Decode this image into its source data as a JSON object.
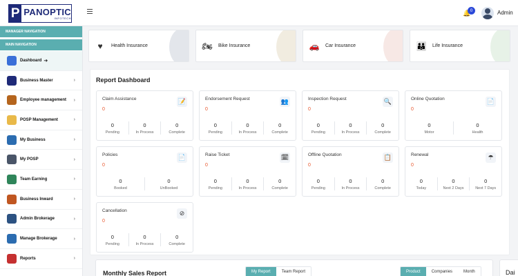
{
  "header": {
    "logo_title": "PANOPTIC",
    "logo_sub": "INFOTECH",
    "notification_count": "0",
    "user_name": "Admin"
  },
  "sidebar": {
    "headings": [
      "MANAGER NAVIGATION",
      "MAIN NAVIGATION"
    ],
    "items": [
      {
        "label": "Dashboard",
        "icon": "dashboard-icon",
        "active": true,
        "arrow": "➔"
      },
      {
        "label": "Business Master",
        "icon": "business-master-icon",
        "arrow": "›"
      },
      {
        "label": "Employee management",
        "icon": "employee-icon",
        "arrow": "›"
      },
      {
        "label": "POSP Management",
        "icon": "posp-icon",
        "arrow": "›"
      },
      {
        "label": "My Business",
        "icon": "my-business-icon",
        "arrow": "›"
      },
      {
        "label": "My POSP",
        "icon": "my-posp-icon",
        "arrow": "›"
      },
      {
        "label": "Team Earning",
        "icon": "team-earning-icon",
        "arrow": "›"
      },
      {
        "label": "Business Inward",
        "icon": "business-inward-icon",
        "arrow": "›"
      },
      {
        "label": "Admin Brokerage",
        "icon": "admin-brokerage-icon",
        "arrow": "›"
      },
      {
        "label": "Manage Brokerage",
        "icon": "manage-brokerage-icon",
        "arrow": "›"
      },
      {
        "label": "Reports",
        "icon": "reports-icon",
        "arrow": "›"
      }
    ]
  },
  "insurance": [
    {
      "label": "Health Insurance",
      "icon": "health-icon",
      "color": "#c7cdd8",
      "glyph": "♥"
    },
    {
      "label": "Bike Insurance",
      "icon": "bike-icon",
      "color": "#e4d9c1",
      "glyph": "🏍"
    },
    {
      "label": "Car Insurance",
      "icon": "car-icon",
      "color": "#f0d2cc",
      "glyph": "🚗"
    },
    {
      "label": "Life Insurance",
      "icon": "life-icon",
      "color": "#cfe6cf",
      "glyph": "👪"
    }
  ],
  "report": {
    "title": "Report Dashboard",
    "cards": [
      {
        "title": "Claim Assistance",
        "total": "0",
        "icon": "claim-icon",
        "glyph": "📝",
        "stats": [
          {
            "v": "0",
            "l": "Pending"
          },
          {
            "v": "0",
            "l": "In Process"
          },
          {
            "v": "0",
            "l": "Complete"
          }
        ]
      },
      {
        "title": "Endorsement Request",
        "total": "0",
        "icon": "endorsement-icon",
        "glyph": "👥",
        "stats": [
          {
            "v": "0",
            "l": "Pending"
          },
          {
            "v": "0",
            "l": "In Process"
          },
          {
            "v": "0",
            "l": "Complete"
          }
        ]
      },
      {
        "title": "Inspection Request",
        "total": "0",
        "icon": "inspection-icon",
        "glyph": "🔍",
        "stats": [
          {
            "v": "0",
            "l": "Pending"
          },
          {
            "v": "0",
            "l": "In Process"
          },
          {
            "v": "0",
            "l": "Complete"
          }
        ]
      },
      {
        "title": "Online Quotation",
        "total": "0",
        "icon": "online-quotation-icon",
        "glyph": "📄",
        "stats": [
          {
            "v": "0",
            "l": "Motor"
          },
          {
            "v": "0",
            "l": "Health"
          }
        ]
      },
      {
        "title": "Policies",
        "total": "0",
        "icon": "policies-icon",
        "glyph": "📄",
        "stats": [
          {
            "v": "0",
            "l": "Booked"
          },
          {
            "v": "0",
            "l": "UnBooked"
          }
        ]
      },
      {
        "title": "Raise Ticket",
        "total": "0",
        "icon": "ticket-icon",
        "glyph": "🗓",
        "stats": [
          {
            "v": "0",
            "l": "Pending"
          },
          {
            "v": "0",
            "l": "In Process"
          },
          {
            "v": "0",
            "l": "Complete"
          }
        ]
      },
      {
        "title": "Offline Quotation",
        "total": "0",
        "icon": "offline-quotation-icon",
        "glyph": "📋",
        "stats": [
          {
            "v": "0",
            "l": "Pending"
          },
          {
            "v": "0",
            "l": "In Process"
          },
          {
            "v": "0",
            "l": "Complete"
          }
        ]
      },
      {
        "title": "Renewal",
        "total": "0",
        "icon": "renewal-icon",
        "glyph": "☂",
        "stats": [
          {
            "v": "0",
            "l": "Today"
          },
          {
            "v": "0",
            "l": "Next 2 Days"
          },
          {
            "v": "0",
            "l": "Next 7 Days"
          }
        ]
      },
      {
        "title": "Cancellation",
        "total": "0",
        "icon": "cancellation-icon",
        "glyph": "⊘",
        "stats": [
          {
            "v": "0",
            "l": "Pending"
          },
          {
            "v": "0",
            "l": "In Process"
          },
          {
            "v": "0",
            "l": "Complete"
          }
        ]
      }
    ]
  },
  "monthly": {
    "title": "Monthly Sales Report",
    "tabs_a": [
      {
        "label": "My Report",
        "on": true
      },
      {
        "label": "Team Report",
        "on": false
      }
    ],
    "tabs_b": [
      {
        "label": "Product",
        "on": true
      },
      {
        "label": "Companies",
        "on": false
      },
      {
        "label": "Month",
        "on": false
      }
    ],
    "daily_title": "Dai"
  },
  "colors": {
    "accent": "#5aaeb0",
    "brand": "#1e2a78",
    "alert": "#e8552b",
    "badge": "#2b49d8"
  }
}
